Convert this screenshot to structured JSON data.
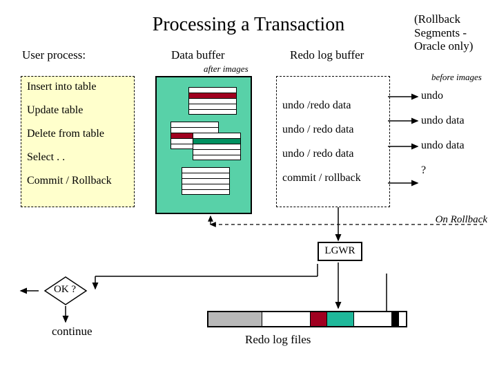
{
  "title": "Processing a Transaction",
  "rollback_note": "(Rollback Segments - Oracle only)",
  "headers": {
    "user": "User process:",
    "data_buffer": "Data buffer",
    "redo_log": "Redo log buffer"
  },
  "after_images": "after images",
  "before_images": "before images",
  "user_ops": {
    "insert": "Insert into table",
    "update": "Update table",
    "delete": "Delete from table",
    "select": "Select . .",
    "commit": "Commit / Rollback"
  },
  "redo_entries": {
    "e1": "undo /redo data",
    "e2": "undo / redo data",
    "e3": "undo / redo data",
    "e4": "commit / rollback"
  },
  "oracle_entries": {
    "o1": "undo",
    "o2": "undo data",
    "o3": "undo data",
    "o4": "?"
  },
  "on_rollback": "On Rollback",
  "lgwr": "LGWR",
  "ok": "OK ?",
  "continue": "continue",
  "redo_files": "Redo log  files"
}
